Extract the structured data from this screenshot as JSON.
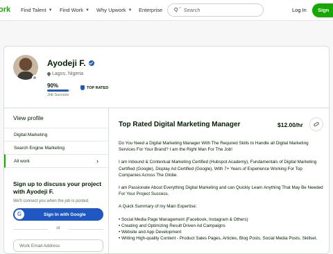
{
  "header": {
    "logo": "ork",
    "nav": [
      {
        "label": "Find Talent",
        "chevron": true
      },
      {
        "label": "Find Work",
        "chevron": true
      },
      {
        "label": "Why Upwork",
        "chevron": true
      },
      {
        "label": "Enterprise",
        "chevron": false
      }
    ],
    "search_scope": "Q ˇ",
    "search_placeholder": "Search",
    "login_label": "Log In",
    "signup_label": "Sign"
  },
  "profile": {
    "name": "Ayodeji F.",
    "location": "Lagos, Nigeria",
    "job_success_pct": "90%",
    "job_success_value": 0.9,
    "job_success_label": "Job Success",
    "badge": "TOP RATED"
  },
  "sidebar": {
    "view_profile": "View profile",
    "items": [
      {
        "label": "Digital Marketing"
      },
      {
        "label": "Search Engine Marketing"
      },
      {
        "label": "All work"
      }
    ],
    "signup_title": "Sign up to discuss your project with Ayodeji F.",
    "signup_sub": "We'll connect you when the job is posted.",
    "google_btn": "Sign In with Google",
    "or": "or",
    "email_placeholder": "Work Email Address"
  },
  "main": {
    "headline": "Top Rated Digital Marketing Manager",
    "rate": "$12.00/hr",
    "paragraphs": [
      "Do You Need a Digital Marketing Manager With The Required Skills to Handle all Digital Marketing Services For Your Brand? I am the Right Man For The Job!",
      "I am Inbound & Contextual Marketing Certified (Hubspot Academy), Fundamentals of Digital Marketing Certified (Google), Display Ad Certified (Google), With 7+ Years of Experience Working For Top Companies Across The Globe.",
      "I am Passionate About Everything Digital Marketing and can Quickly Learn Anything That May Be Needed For Your Project Success.",
      "A Quick Summary of my Main Expertise:"
    ],
    "bullets": [
      "• Social Media Page Management (Facebook, Instagram & Others)",
      "• Creating and Optimizing Result Driven Ad Campaigns",
      "• Website and App Development",
      "• Writing High-quality Content - Product Sales Pages, Articles, Blog Posts, Social Media Posts, Skillset."
    ]
  }
}
